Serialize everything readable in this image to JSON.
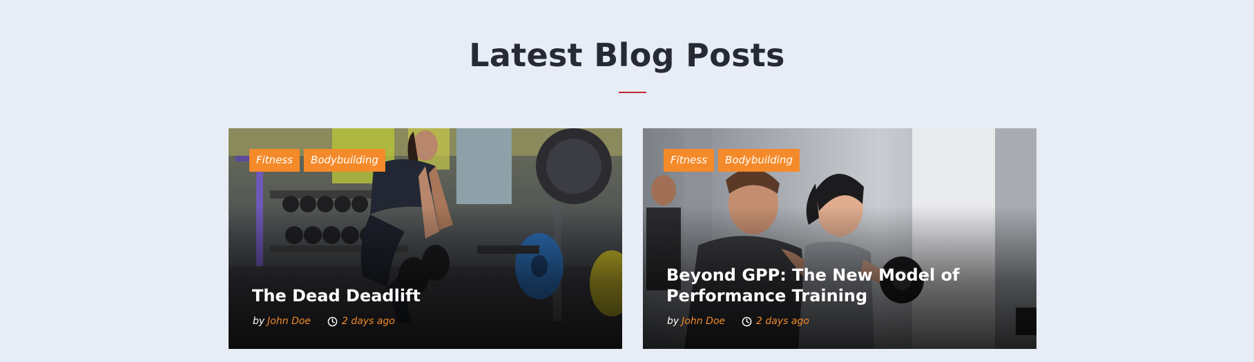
{
  "section": {
    "title": "Latest Blog Posts"
  },
  "colors": {
    "background": "#e8ecf5",
    "accent": "#f58a2a",
    "underline": "#c0272d",
    "title": "#262a33"
  },
  "posts": [
    {
      "title": "The Dead Deadlift",
      "tags": [
        "Fitness",
        "Bodybuilding"
      ],
      "by_label": "by",
      "author": "John Doe",
      "time": "2 days ago",
      "time_icon": "clock-icon",
      "image": "photo of a woman lifting dumbbells in a gym"
    },
    {
      "title": "Beyond GPP: The New Model of Performance Training",
      "tags": [
        "Fitness",
        "Bodybuilding"
      ],
      "by_label": "by",
      "author": "John Doe",
      "time": "2 days ago",
      "time_icon": "clock-icon",
      "image": "photo of a trainer assisting a woman with dumbbells"
    }
  ]
}
